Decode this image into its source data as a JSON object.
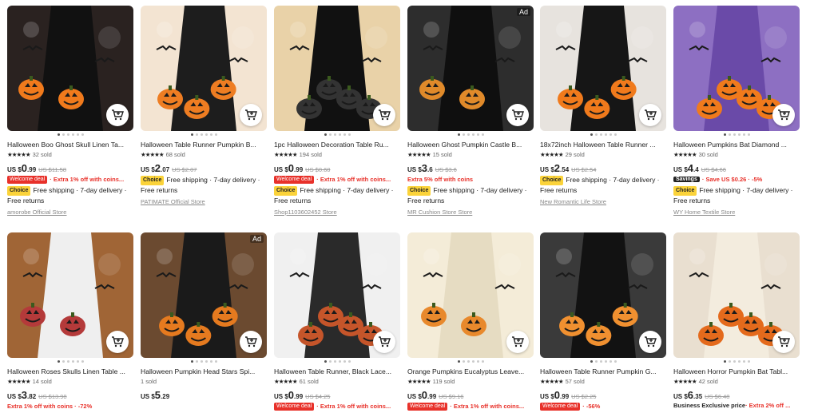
{
  "colors": {
    "accent_red": "#e8312a",
    "choice_yellow": "#fbd33a"
  },
  "products": [
    {
      "title": "Halloween Boo Ghost Skull Linen Ta...",
      "rating": "★★★★★",
      "sold": "32 sold",
      "cur": "US $",
      "int": "0",
      "dec": ".99",
      "orig": "US $11.58",
      "badge": "Welcome deal",
      "promo": "· Extra 1% off with coins...",
      "ship1": "Free shipping · 7-day delivery ·",
      "ship2": "Free returns",
      "choice": "Choice",
      "store": "amorobe Official Store",
      "ad": ""
    },
    {
      "title": "Halloween Table Runner Pumpkin B...",
      "rating": "★★★★★",
      "sold": "68 sold",
      "cur": "US $",
      "int": "2",
      "dec": ".07",
      "orig": "US $2.07",
      "badge": "",
      "promo": "",
      "ship1": "Free shipping · 7-day delivery ·",
      "ship2": "Free returns",
      "choice": "Choice",
      "store": "PATIMATE Official Store",
      "ad": ""
    },
    {
      "title": "1pc Halloween Decoration Table Ru...",
      "rating": "★★★★★",
      "sold": "194 sold",
      "cur": "US $",
      "int": "0",
      "dec": ".99",
      "orig": "US $0.60",
      "badge": "Welcome deal",
      "promo": "· Extra 1% off with coins...",
      "ship1": "Free shipping · 7-day delivery ·",
      "ship2": "Free returns",
      "choice": "Choice",
      "store": "Shop1103602452 Store",
      "ad": ""
    },
    {
      "title": "Halloween Ghost Pumpkin Castle B...",
      "rating": "★★★★★",
      "sold": "15 sold",
      "cur": "US $",
      "int": "3",
      "dec": ".6",
      "orig": "US $3.6",
      "badge": "",
      "promo": "Extra 5% off with coins",
      "ship1": "Free shipping · 7-day delivery ·",
      "ship2": "Free returns",
      "choice": "Choice",
      "store": "MR Cushion Store Store",
      "ad": "Ad"
    },
    {
      "title": "18x72inch Halloween Table Runner ...",
      "rating": "★★★★★",
      "sold": "29 sold",
      "cur": "US $",
      "int": "2",
      "dec": ".54",
      "orig": "US $2.54",
      "badge": "",
      "promo": "",
      "ship1": "Free shipping · 7-day delivery ·",
      "ship2": "Free returns",
      "choice": "Choice",
      "store": "New Romantic Life Store",
      "ad": ""
    },
    {
      "title": "Halloween Pumpkins Bat Diamond ...",
      "rating": "★★★★★",
      "sold": "30 sold",
      "cur": "US $",
      "int": "4",
      "dec": ".4",
      "orig": "US $4.66",
      "badge": "Savings",
      "promo": "· Save US $0.26 · -5%",
      "ship1": "Free shipping · 7-day delivery ·",
      "ship2": "Free returns",
      "choice": "Choice",
      "store": "WY Home Textile Store",
      "ad": ""
    },
    {
      "title": "Halloween Roses Skulls Linen Table ...",
      "rating": "★★★★★",
      "sold": "14 sold",
      "cur": "US $",
      "int": "3",
      "dec": ".82",
      "orig": "US $13.98",
      "badge": "",
      "promo": "Extra 1% off with coins · -72%",
      "ship1": "",
      "ship2": "",
      "choice": "",
      "store": "",
      "ad": ""
    },
    {
      "title": "Halloween Pumpkin Head Stars Spi...",
      "rating": "",
      "sold": "1 sold",
      "cur": "US $",
      "int": "5",
      "dec": ".29",
      "orig": "",
      "badge": "",
      "promo": "",
      "ship1": "",
      "ship2": "",
      "choice": "",
      "store": "",
      "ad": "Ad"
    },
    {
      "title": "Halloween Table Runner, Black Lace...",
      "rating": "★★★★★",
      "sold": "61 sold",
      "cur": "US $",
      "int": "0",
      "dec": ".99",
      "orig": "US $4.25",
      "badge": "Welcome deal",
      "promo": "· Extra 1% off with coins...",
      "ship1": "",
      "ship2": "",
      "choice": "",
      "store": "",
      "ad": ""
    },
    {
      "title": "Orange Pumpkins Eucalyptus Leave...",
      "rating": "★★★★★",
      "sold": "119 sold",
      "cur": "US $",
      "int": "0",
      "dec": ".99",
      "orig": "US $9.16",
      "badge": "Welcome deal",
      "promo": "· Extra 1% off with coins...",
      "ship1": "",
      "ship2": "",
      "choice": "",
      "store": "",
      "ad": ""
    },
    {
      "title": "Halloween Table Runner Pumpkin G...",
      "rating": "★★★★★",
      "sold": "57 sold",
      "cur": "US $",
      "int": "0",
      "dec": ".99",
      "orig": "US $2.25",
      "badge": "Welcome deal",
      "promo": "· -56%",
      "ship1": "",
      "ship2": "",
      "choice": "",
      "store": "",
      "ad": ""
    },
    {
      "title": "Halloween Horror Pumpkin Bat Tabl...",
      "rating": "★★★★★",
      "sold": "42 sold",
      "cur": "US $",
      "int": "6",
      "dec": ".35",
      "orig": "US $6.48",
      "badge": "",
      "promo": "",
      "ship1": "",
      "ship2": "",
      "choice": "",
      "store": "",
      "biz": "Business Exclusive price",
      "biz2": "· Extra 2% off ...",
      "ad": ""
    }
  ]
}
